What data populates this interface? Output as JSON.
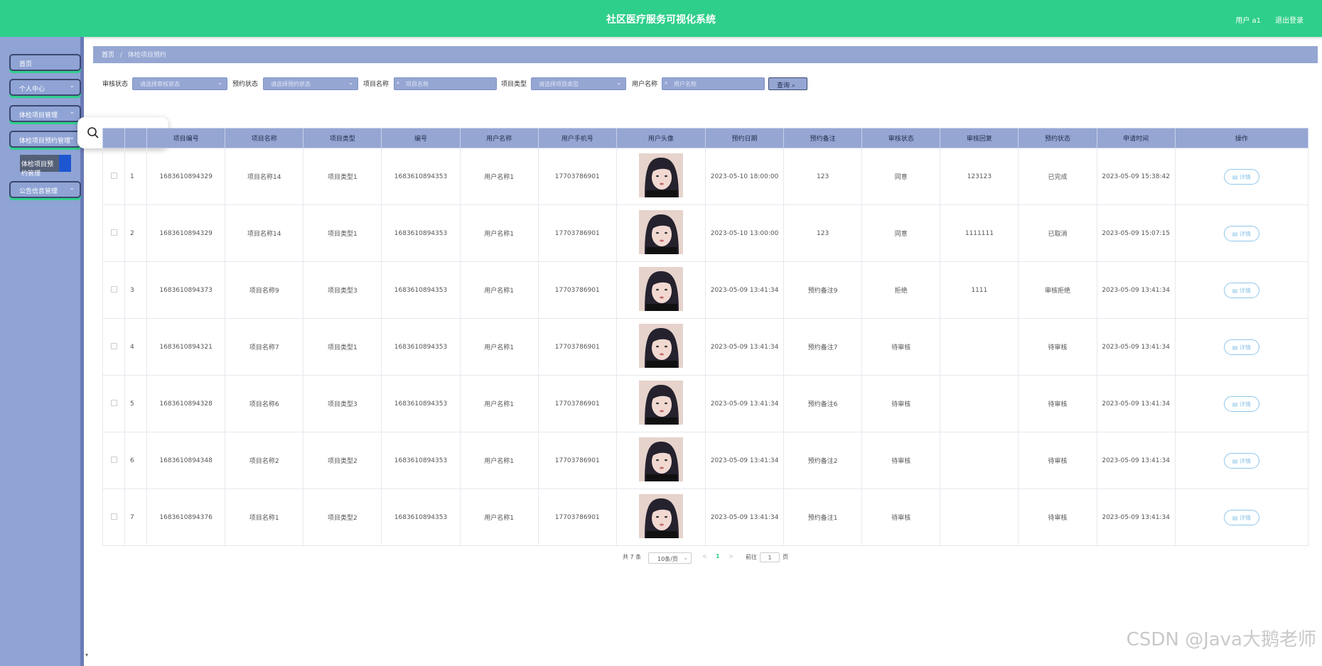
{
  "header": {
    "title": "社区医疗服务可视化系统",
    "user": "用户 a1",
    "logout": "退出登录"
  },
  "sidebar": {
    "items": [
      {
        "label": "首页",
        "chevron": false
      },
      {
        "label": "个人中心",
        "chevron": true
      },
      {
        "label": "体检项目管理",
        "chevron": true
      },
      {
        "label": "体检项目预约管理",
        "chevron": true
      },
      {
        "label": "公告信息管理",
        "chevron": true
      }
    ],
    "submenu": "体检项目预约管理"
  },
  "breadcrumb": {
    "home": "首页",
    "sep": "/",
    "current": "体检项目预约"
  },
  "filters": {
    "audit_label": "审核状态",
    "audit_placeholder": "请选择审核状态",
    "booking_label": "预约状态",
    "booking_placeholder": "请选择预约状态",
    "name_label": "项目名称",
    "name_placeholder": "项目名称",
    "type_label": "项目类型",
    "type_placeholder": "请选择项目类型",
    "user_label": "用户名称",
    "user_placeholder": "用户名称",
    "query_label": "查询",
    "icons": {
      "dropdown": "chevron-down-icon",
      "search": "search-icon"
    }
  },
  "popup": {
    "label": "搜索",
    "more": "···"
  },
  "table": {
    "headers": [
      "项目编号",
      "项目名称",
      "项目类型",
      "编号",
      "用户名称",
      "用户手机号",
      "用户头像",
      "预约日期",
      "预约备注",
      "审核状态",
      "审核回复",
      "预约状态",
      "申请时间",
      "操作"
    ],
    "detail_label": "▤ 详情",
    "rows": [
      {
        "idx": "1",
        "code": "1683610894329",
        "name": "项目名称14",
        "type": "项目类型1",
        "num": "1683610894353",
        "user": "用户名称1",
        "phone": "17703786901",
        "date": "2023-05-10 18:00:00",
        "note": "123",
        "audit": "同意",
        "reply": "123123",
        "status": "已完成",
        "applied": "2023-05-09 15:38:42"
      },
      {
        "idx": "2",
        "code": "1683610894329",
        "name": "项目名称14",
        "type": "项目类型1",
        "num": "1683610894353",
        "user": "用户名称1",
        "phone": "17703786901",
        "date": "2023-05-10 13:00:00",
        "note": "123",
        "audit": "同意",
        "reply": "1111111",
        "status": "已取消",
        "applied": "2023-05-09 15:07:15"
      },
      {
        "idx": "3",
        "code": "1683610894373",
        "name": "项目名称9",
        "type": "项目类型3",
        "num": "1683610894353",
        "user": "用户名称1",
        "phone": "17703786901",
        "date": "2023-05-09 13:41:34",
        "note": "预约备注9",
        "audit": "拒绝",
        "reply": "1111",
        "status": "审核拒绝",
        "applied": "2023-05-09 13:41:34"
      },
      {
        "idx": "4",
        "code": "1683610894321",
        "name": "项目名称7",
        "type": "项目类型1",
        "num": "1683610894353",
        "user": "用户名称1",
        "phone": "17703786901",
        "date": "2023-05-09 13:41:34",
        "note": "预约备注7",
        "audit": "待审核",
        "reply": "",
        "status": "待审核",
        "applied": "2023-05-09 13:41:34"
      },
      {
        "idx": "5",
        "code": "1683610894328",
        "name": "项目名称6",
        "type": "项目类型3",
        "num": "1683610894353",
        "user": "用户名称1",
        "phone": "17703786901",
        "date": "2023-05-09 13:41:34",
        "note": "预约备注6",
        "audit": "待审核",
        "reply": "",
        "status": "待审核",
        "applied": "2023-05-09 13:41:34"
      },
      {
        "idx": "6",
        "code": "1683610894348",
        "name": "项目名称2",
        "type": "项目类型2",
        "num": "1683610894353",
        "user": "用户名称1",
        "phone": "17703786901",
        "date": "2023-05-09 13:41:34",
        "note": "预约备注2",
        "audit": "待审核",
        "reply": "",
        "status": "待审核",
        "applied": "2023-05-09 13:41:34"
      },
      {
        "idx": "7",
        "code": "1683610894376",
        "name": "项目名称1",
        "type": "项目类型2",
        "num": "1683610894353",
        "user": "用户名称1",
        "phone": "17703786901",
        "date": "2023-05-09 13:41:34",
        "note": "预约备注1",
        "audit": "待审核",
        "reply": "",
        "status": "待审核",
        "applied": "2023-05-09 13:41:34"
      }
    ]
  },
  "pagination": {
    "total": "共 7 条",
    "page_size": "10条/页",
    "prev": "<",
    "current": "1",
    "next": ">",
    "goto": "前往",
    "page_value": "1",
    "page_suffix": "页"
  },
  "watermark": "CSDN @Java大鹅老师",
  "colors": {
    "header": "#2ecf8a",
    "sidebar": "#8fa3d4",
    "table_head": "#95a6d3",
    "accent_blue": "#1c57d1"
  }
}
